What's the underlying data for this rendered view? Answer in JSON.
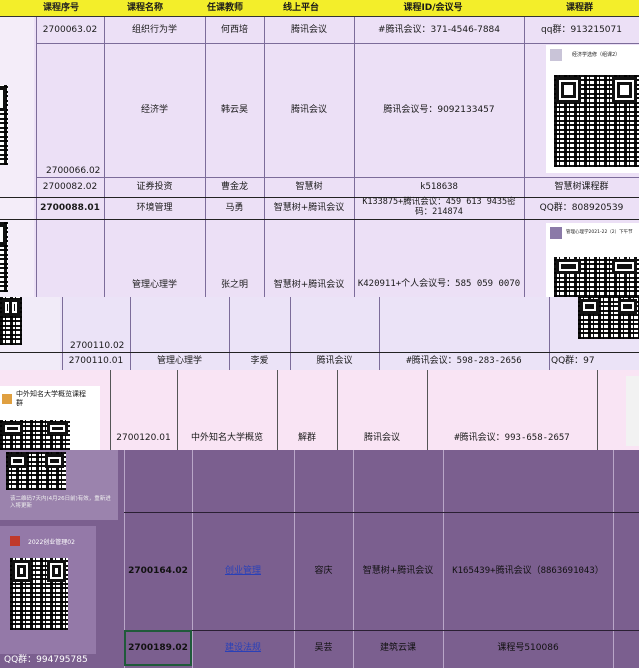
{
  "header": {
    "col_id": "课程序号",
    "col_name": "课程名称",
    "col_teacher": "任课教师",
    "col_platform": "线上平台",
    "col_meeting": "课程ID/会议号",
    "col_group": "课程群"
  },
  "rows": [
    {
      "id": "2700063.02",
      "name": "组织行为学",
      "teacher": "何西培",
      "platform": "腾讯会议",
      "meeting": "#腾讯会议：371-4546-7884",
      "group": "qq群：913215071"
    },
    {
      "id": "2700066.02",
      "name": "经济学",
      "teacher": "韩云昊",
      "platform": "腾讯会议",
      "meeting": "腾讯会议号：9092133457",
      "group_caption": "经济学选修（组课2）"
    },
    {
      "id": "2700082.02",
      "name": "证券投资",
      "teacher": "曹金龙",
      "platform": "智慧树",
      "meeting": "k518638",
      "group": "智慧树课程群"
    },
    {
      "id": "2700088.01",
      "name": "环境管理",
      "teacher": "马勇",
      "platform": "智慧树+腾讯会议",
      "meeting": "K133875+腾讯会议：459 613 9435密码：214874",
      "group": "QQ群：808920539"
    },
    {
      "id": "2700110.02",
      "name": "管理心理学",
      "teacher": "张之明",
      "platform": "智慧树+腾讯会议",
      "meeting": "K420911+个人会议号：585 059 0070",
      "group_caption": "管理心理学2021-22（2）下午节"
    },
    {
      "id": "2700110.01",
      "name": "管理心理学",
      "teacher": "李爱",
      "platform": "腾讯会议",
      "meeting": "#腾讯会议：598-283-2656",
      "group": "QQ群：97"
    },
    {
      "id": "2700120.01",
      "name": "中外知名大学概览",
      "teacher": "解群",
      "platform": "腾讯会议",
      "meeting": "#腾讯会议：993-658-2657",
      "group_caption": "中外知名大学概览课程群",
      "group_note": "该二维码7天内(4月26日前)有效，重新进入将更新"
    },
    {
      "id": "2700164.02",
      "name": "创业管理",
      "teacher": "容庆",
      "platform": "智慧树+腾讯会议",
      "meeting": "K165439+腾讯会议（8863691043）",
      "group_caption": "2022创业管理02"
    },
    {
      "id": "2700189.02",
      "name": "建设法规",
      "teacher": "吴芸",
      "platform": "建筑云课",
      "meeting": "课程号510086",
      "group": "QQ群：994795785"
    }
  ],
  "colors": {
    "band_lavender": "#ece0f6",
    "band_pink": "#f9e3f3",
    "band_purple": "#7a5c8e",
    "header_yellow": "#f5ef18",
    "link_blue": "#2940b8"
  },
  "icons": [
    "qr-code-icon",
    "group-avatar-icon"
  ]
}
